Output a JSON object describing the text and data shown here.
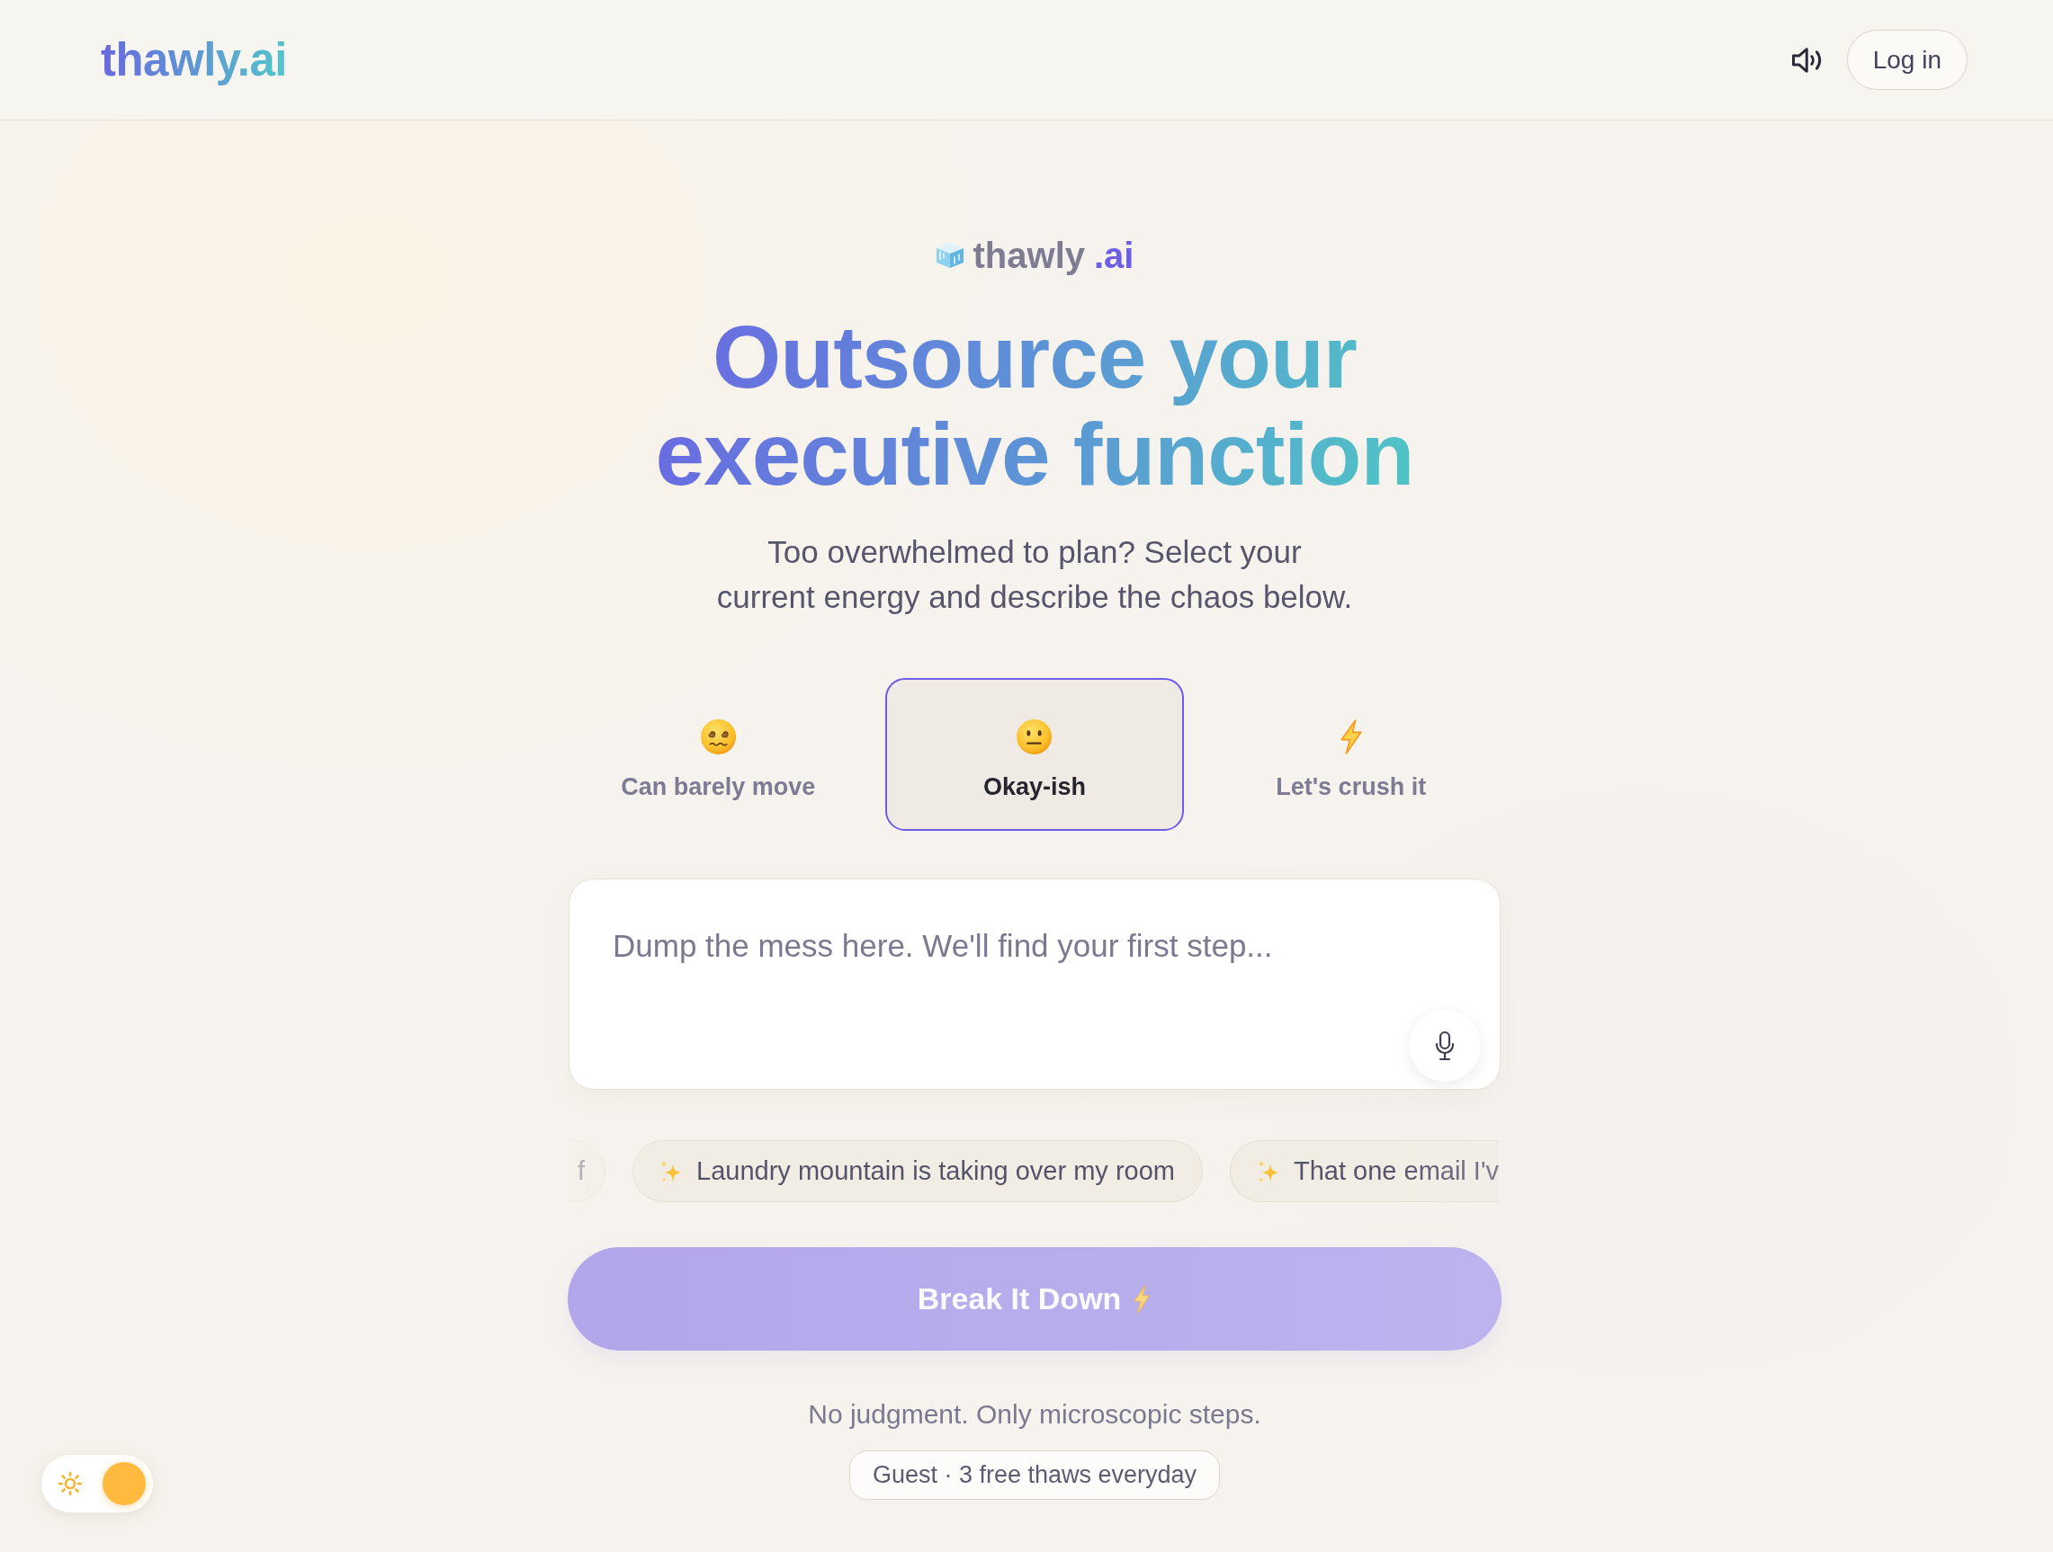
{
  "header": {
    "logo": "thawly.ai",
    "sound_on": true,
    "login_button": "Log in"
  },
  "hero": {
    "brand": {
      "name": "thawly",
      "suffix": ".ai"
    },
    "headline": "Outsource your executive function",
    "subtitle": "Too overwhelmed to plan? Select your current energy and describe the chaos below."
  },
  "energy_options": [
    {
      "label": "Can barely move",
      "selected": false
    },
    {
      "label": "Okay-ish",
      "selected": true
    },
    {
      "label": "Let's crush it",
      "selected": false
    }
  ],
  "input": {
    "placeholder": "Dump the mess here. We'll find your first step..."
  },
  "suggestions": [
    {
      "kind": "tail",
      "text": "f"
    },
    {
      "kind": "full",
      "text": "Laundry mountain is taking over my room"
    },
    {
      "kind": "head",
      "text": "That one email I'v"
    }
  ],
  "submit_button": {
    "label": "Break It Down",
    "disabled": true
  },
  "note": "No judgment. Only microscopic steps.",
  "usage_badge": "Guest · 3 free thaws everyday",
  "theme_toggle": {
    "dark_mode": false
  }
}
